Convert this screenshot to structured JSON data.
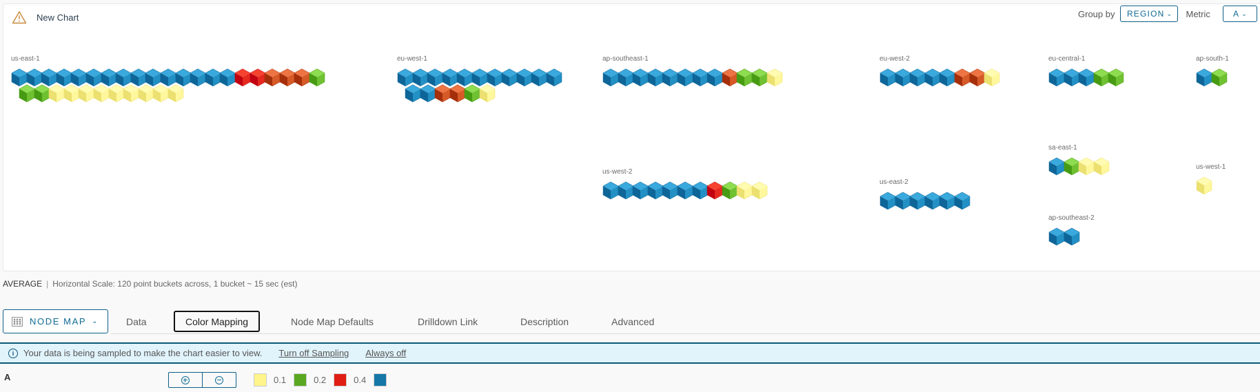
{
  "chart": {
    "title": "New Chart",
    "warning_icon": "warning-triangle-icon",
    "group_by_label": "Group by",
    "group_by_value": "REGION",
    "metric_label": "Metric",
    "metric_value": "A"
  },
  "status_colors": {
    "blue": "#1a7aad",
    "red": "#e01e14",
    "orange": "#d85a28",
    "green": "#5aa820",
    "yellow": "#fff58a"
  },
  "groups": [
    {
      "name": "us-east-1",
      "nodes": [
        "blue",
        "blue",
        "blue",
        "blue",
        "blue",
        "blue",
        "blue",
        "blue",
        "blue",
        "blue",
        "blue",
        "blue",
        "blue",
        "blue",
        "blue",
        "red",
        "red",
        "orange",
        "orange",
        "orange",
        "green",
        "green",
        "green",
        "yellow",
        "yellow",
        "yellow",
        "yellow",
        "yellow",
        "yellow",
        "yellow",
        "yellow",
        "yellow"
      ]
    },
    {
      "name": "eu-west-1",
      "nodes": [
        "blue",
        "blue",
        "blue",
        "blue",
        "blue",
        "blue",
        "blue",
        "blue",
        "blue",
        "blue",
        "blue",
        "blue",
        "blue",
        "orange",
        "orange",
        "green",
        "yellow"
      ]
    },
    {
      "name": "ap-southeast-1",
      "nodes": [
        "blue",
        "blue",
        "blue",
        "blue",
        "blue",
        "blue",
        "blue",
        "blue",
        "orange",
        "green",
        "green",
        "yellow"
      ]
    },
    {
      "name": "eu-west-2",
      "nodes": [
        "blue",
        "blue",
        "blue",
        "blue",
        "blue",
        "orange",
        "orange",
        "yellow"
      ]
    },
    {
      "name": "eu-central-1",
      "nodes": [
        "blue",
        "blue",
        "blue",
        "green",
        "green"
      ]
    },
    {
      "name": "ap-south-1",
      "nodes": [
        "blue",
        "green"
      ]
    },
    {
      "name": "us-west-2",
      "nodes": [
        "blue",
        "blue",
        "blue",
        "blue",
        "blue",
        "blue",
        "blue",
        "red",
        "green",
        "yellow",
        "yellow"
      ]
    },
    {
      "name": "us-east-2",
      "nodes": [
        "blue",
        "blue",
        "blue",
        "blue",
        "blue",
        "blue"
      ]
    },
    {
      "name": "sa-east-1",
      "nodes": [
        "blue",
        "green",
        "yellow",
        "yellow"
      ]
    },
    {
      "name": "us-west-1",
      "nodes": [
        "yellow"
      ]
    },
    {
      "name": "ap-southeast-2",
      "nodes": [
        "blue",
        "blue"
      ]
    }
  ],
  "footer": {
    "aggregation": "AVERAGE",
    "separator": "|",
    "scale_text": "Horizontal Scale: 120 point buckets across, 1 bucket ~ 15 sec (est)"
  },
  "tabs": {
    "chart_type": "NODE MAP",
    "items": [
      "Data",
      "Color Mapping",
      "Node Map Defaults",
      "Drilldown Link",
      "Description",
      "Advanced"
    ],
    "active": "Color Mapping"
  },
  "banner": {
    "message": "Your data is being sampled to make the chart easier to view.",
    "turn_off": "Turn off Sampling",
    "always_off": "Always off"
  },
  "color_mapping": {
    "metric": "A",
    "swatches": [
      {
        "color": "#fff58a",
        "threshold": "0.1"
      },
      {
        "color": "#5aa820",
        "threshold": "0.2"
      },
      {
        "color": "#e01e14",
        "threshold": "0.4"
      },
      {
        "color": "#1577a8",
        "threshold": ""
      }
    ]
  }
}
